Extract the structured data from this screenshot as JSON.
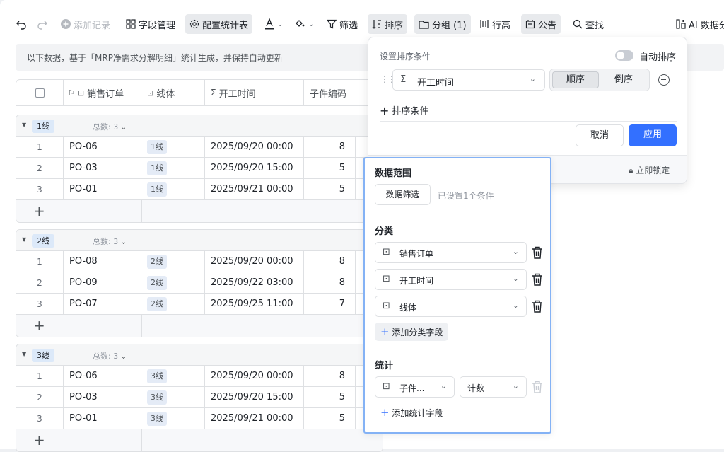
{
  "toolbar": {
    "add_record": "添加记录",
    "field_manage": "字段管理",
    "config_stats": "配置统计表",
    "filter": "筛选",
    "sort": "排序",
    "group": "分组 (1)",
    "row_height": "行高",
    "announcement": "公告",
    "find": "查找",
    "ai": "AI 数据分"
  },
  "notice": "以下数据，基于「MRP净需求分解明细」统计生成，并保持自动更新",
  "columns": [
    "销售订单",
    "线体",
    "开工时间",
    "子件编码"
  ],
  "groups": [
    {
      "label": "1线",
      "count": "总数: 3",
      "rows": [
        {
          "n": "1",
          "order": "PO-06",
          "line": "1线",
          "time": "2025/09/20 00:00",
          "code": "8"
        },
        {
          "n": "2",
          "order": "PO-03",
          "line": "1线",
          "time": "2025/09/20 15:00",
          "code": "5"
        },
        {
          "n": "3",
          "order": "PO-01",
          "line": "1线",
          "time": "2025/09/21 00:00",
          "code": "5"
        }
      ]
    },
    {
      "label": "2线",
      "count": "总数: 3",
      "rows": [
        {
          "n": "1",
          "order": "PO-08",
          "line": "2线",
          "time": "2025/09/20 00:00",
          "code": "8"
        },
        {
          "n": "2",
          "order": "PO-09",
          "line": "2线",
          "time": "2025/09/22 03:00",
          "code": "8"
        },
        {
          "n": "3",
          "order": "PO-07",
          "line": "2线",
          "time": "2025/09/25 11:00",
          "code": "7"
        }
      ]
    },
    {
      "label": "3线",
      "count": "总数: 3",
      "rows": [
        {
          "n": "1",
          "order": "PO-06",
          "line": "3线",
          "time": "2025/09/20 00:00",
          "code": "8"
        },
        {
          "n": "2",
          "order": "PO-03",
          "line": "3线",
          "time": "2025/09/20 15:00",
          "code": "5"
        },
        {
          "n": "3",
          "order": "PO-01",
          "line": "3线",
          "time": "2025/09/21 00:00",
          "code": "5"
        }
      ]
    }
  ],
  "sort_panel": {
    "title": "设置排序条件",
    "auto_sort": "自动排序",
    "field": "开工时间",
    "asc": "顺序",
    "desc": "倒序",
    "add_condition": "排序条件",
    "cancel": "取消",
    "apply": "应用",
    "lock": "立即锁定"
  },
  "config_panel": {
    "data_range": "数据范围",
    "data_filter": "数据筛选",
    "filter_note": "已设置1个条件",
    "category": "分类",
    "cat_fields": [
      "销售订单",
      "开工时间",
      "线体"
    ],
    "add_cat": "添加分类字段",
    "stats": "统计",
    "stat_field": "子件...",
    "stat_func": "计数",
    "add_stat": "添加统计字段"
  },
  "colors": {
    "accent": "#3370ff",
    "tag_bg": "#dce9f9",
    "highlight_border": "#84b2f5"
  }
}
